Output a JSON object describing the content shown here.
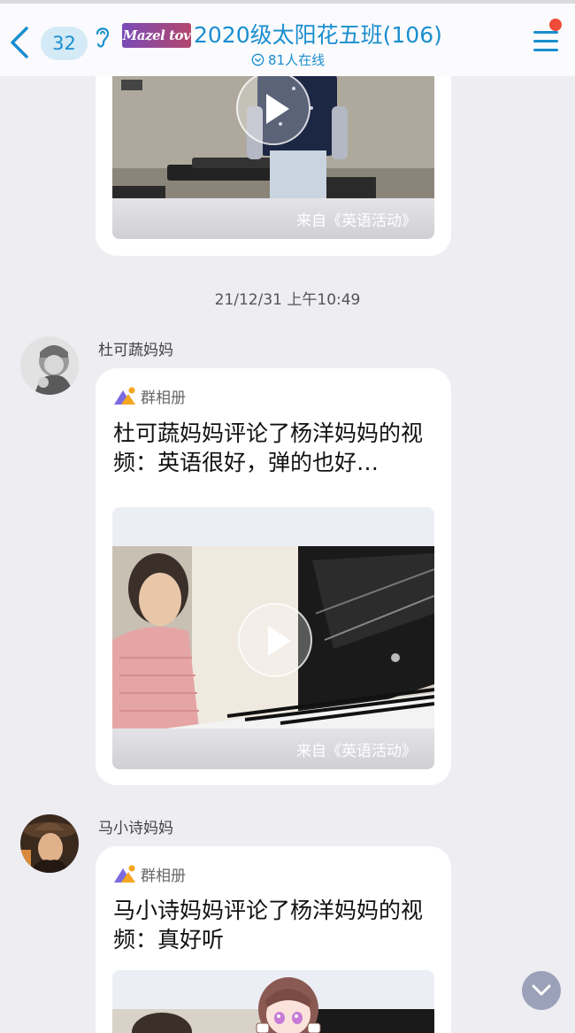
{
  "header": {
    "unread_count": "32",
    "logo_text": "Mazel tov",
    "title": "2020级太阳花五班(106)",
    "online": "81人在线"
  },
  "messages": [
    {
      "source": "来自《英语活动》"
    },
    {
      "timestamp": "21/12/31 上午10:49",
      "sender": "杜可蔬妈妈",
      "album_label": "群相册",
      "text": "杜可蔬妈妈评论了杨洋妈妈的视频：英语很好，弹的也好…",
      "source": "来自《英语活动》"
    },
    {
      "sender": "马小诗妈妈",
      "album_label": "群相册",
      "text": "马小诗妈妈评论了杨洋妈妈的视频：真好听"
    }
  ],
  "colors": {
    "accent": "#1a8ecf",
    "badge_bg": "#d4eaf6",
    "notification_dot": "#f04a3a",
    "chat_bg": "#ededf2"
  }
}
